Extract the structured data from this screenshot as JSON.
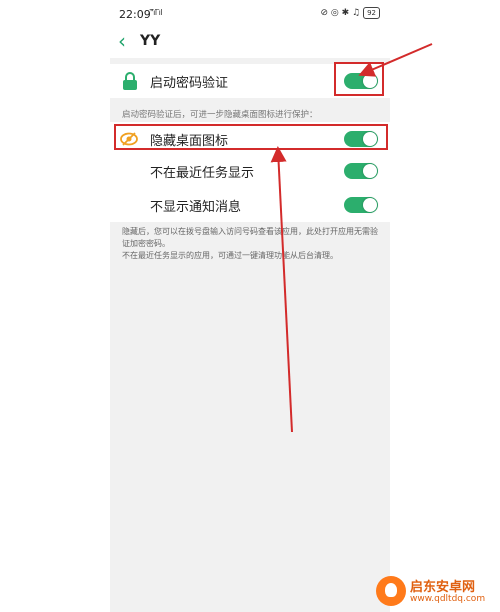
{
  "status_bar": {
    "time": "22:09",
    "signal": "\"̅ıl ̅ıl",
    "right_icons": "⊘ ◎ ✱ ♫",
    "battery": "92"
  },
  "header": {
    "back_icon": "‹",
    "title": "YY"
  },
  "settings": {
    "password_verify": {
      "label": "启动密码验证",
      "enabled": true
    },
    "hint": "启动密码验证后，可进一步隐藏桌面图标进行保护：",
    "hide_icon": {
      "label": "隐藏桌面图标",
      "enabled": true
    },
    "hide_recent": {
      "label": "不在最近任务显示",
      "enabled": true
    },
    "hide_notify": {
      "label": "不显示通知消息",
      "enabled": true
    }
  },
  "notes": {
    "line1": "隐藏后，您可以在拨号盘输入访问号码查看该应用，此处打开应用无需验证加密密码。",
    "line2": "不在最近任务显示的应用，可通过一键清理功能从后台清理。"
  },
  "colors": {
    "accent": "#2cae6d",
    "annotation": "#d32b2b"
  },
  "watermark": {
    "name": "启东安卓网",
    "url": "www.qdltdq.com"
  }
}
